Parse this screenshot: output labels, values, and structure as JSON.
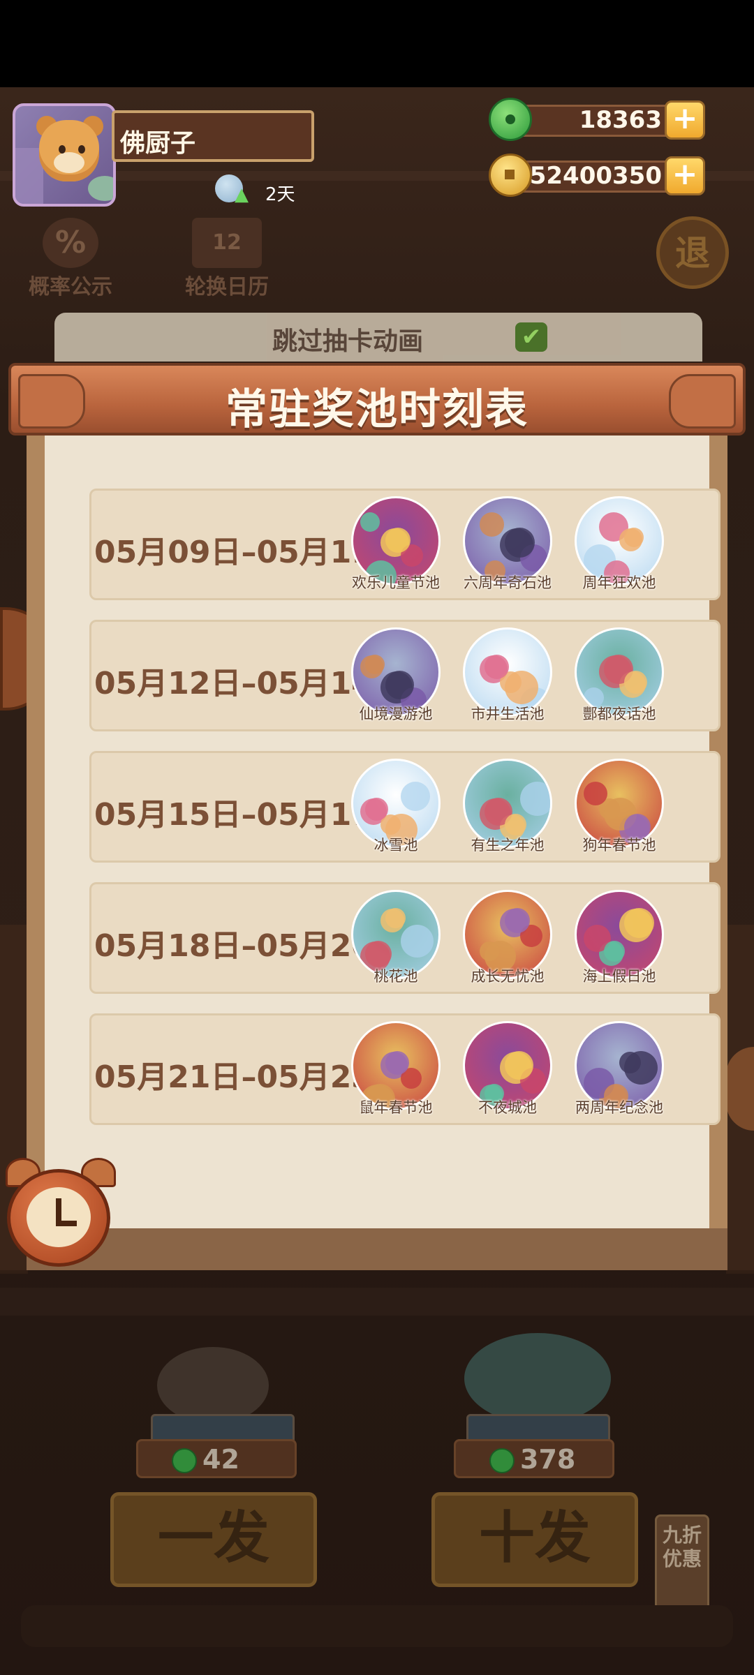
{
  "player": {
    "name": "佛厨子",
    "egg_timer": "2天"
  },
  "currencies": [
    {
      "name": "jade",
      "value": "18363",
      "plus": "+"
    },
    {
      "name": "gold",
      "value": "52400350",
      "plus": "+"
    }
  ],
  "menu": {
    "probability": "概率公示",
    "probability_glyph": "%",
    "calendar": "轮换日历",
    "calendar_glyph": "12",
    "exit": "退"
  },
  "skip_animation": {
    "label": "跳过抽卡动画",
    "checked": true,
    "check_glyph": "✔"
  },
  "schedule": {
    "title": "常驻奖池时刻表",
    "rows": [
      {
        "date": "05月09日–05月11日",
        "pools": [
          "欢乐儿童节池",
          "六周年奇石池",
          "周年狂欢池"
        ]
      },
      {
        "date": "05月12日–05月14日",
        "pools": [
          "仙境漫游池",
          "市井生活池",
          "酆都夜话池"
        ]
      },
      {
        "date": "05月15日–05月17日",
        "pools": [
          "冰雪池",
          "有生之年池",
          "狗年春节池"
        ]
      },
      {
        "date": "05月18日–05月20日",
        "pools": [
          "桃花池",
          "成长无忧池",
          "海上假日池"
        ]
      },
      {
        "date": "05月21日–05月23日",
        "pools": [
          "鼠年春节池",
          "不夜城池",
          "两周年纪念池"
        ]
      }
    ]
  },
  "bottom": {
    "single_cost": "42",
    "ten_cost": "378",
    "single_label": "一发",
    "ten_label": "十发",
    "discount_tag": "九折优惠"
  }
}
